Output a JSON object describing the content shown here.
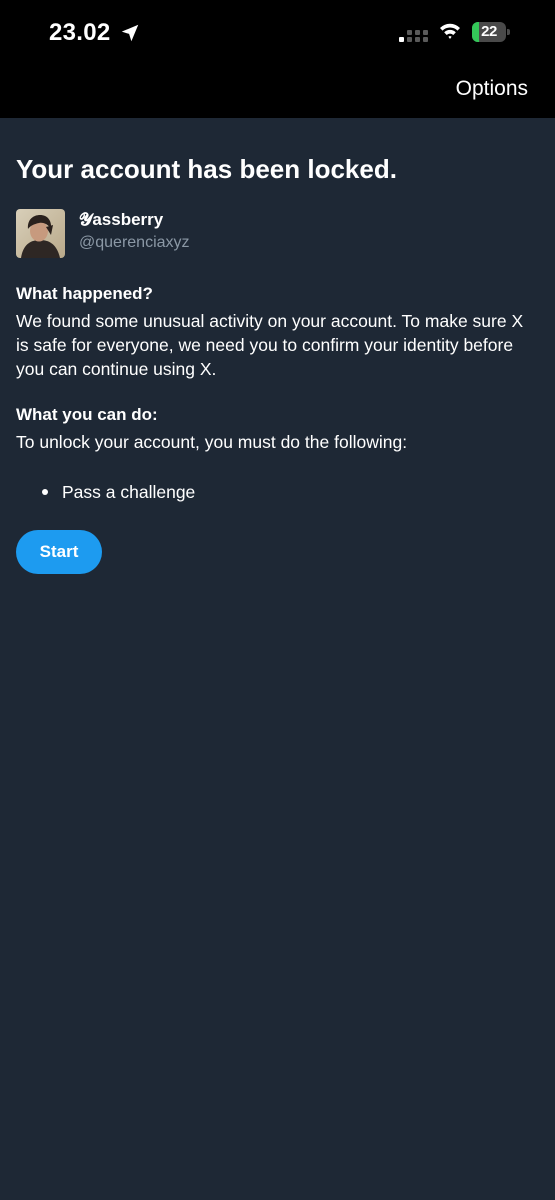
{
  "status_bar": {
    "time": "23.02",
    "location_icon": "location-arrow-icon",
    "signal_icon": "cellular-signal-icon",
    "wifi_icon": "wifi-icon",
    "battery_level": "22",
    "battery_fraction": 0.22,
    "battery_color": "#34c759"
  },
  "header": {
    "options_label": "Options"
  },
  "main": {
    "title": "Your account has been locked.",
    "account": {
      "display_name": "𝓨assberry",
      "handle": "@querenciaxyz"
    },
    "what_happened": {
      "heading": "What happened?",
      "body": "We found some unusual activity on your account. To make sure X is safe for everyone, we need you to confirm your identity before you can continue using X."
    },
    "what_you_can_do": {
      "heading": "What you can do:",
      "body": "To unlock your account, you must do the following:",
      "requirements": [
        "Pass a challenge"
      ]
    },
    "start_label": "Start"
  },
  "colors": {
    "background": "#1e2835",
    "accent": "#1d9bf0",
    "secondary_text": "#8b98a5"
  }
}
